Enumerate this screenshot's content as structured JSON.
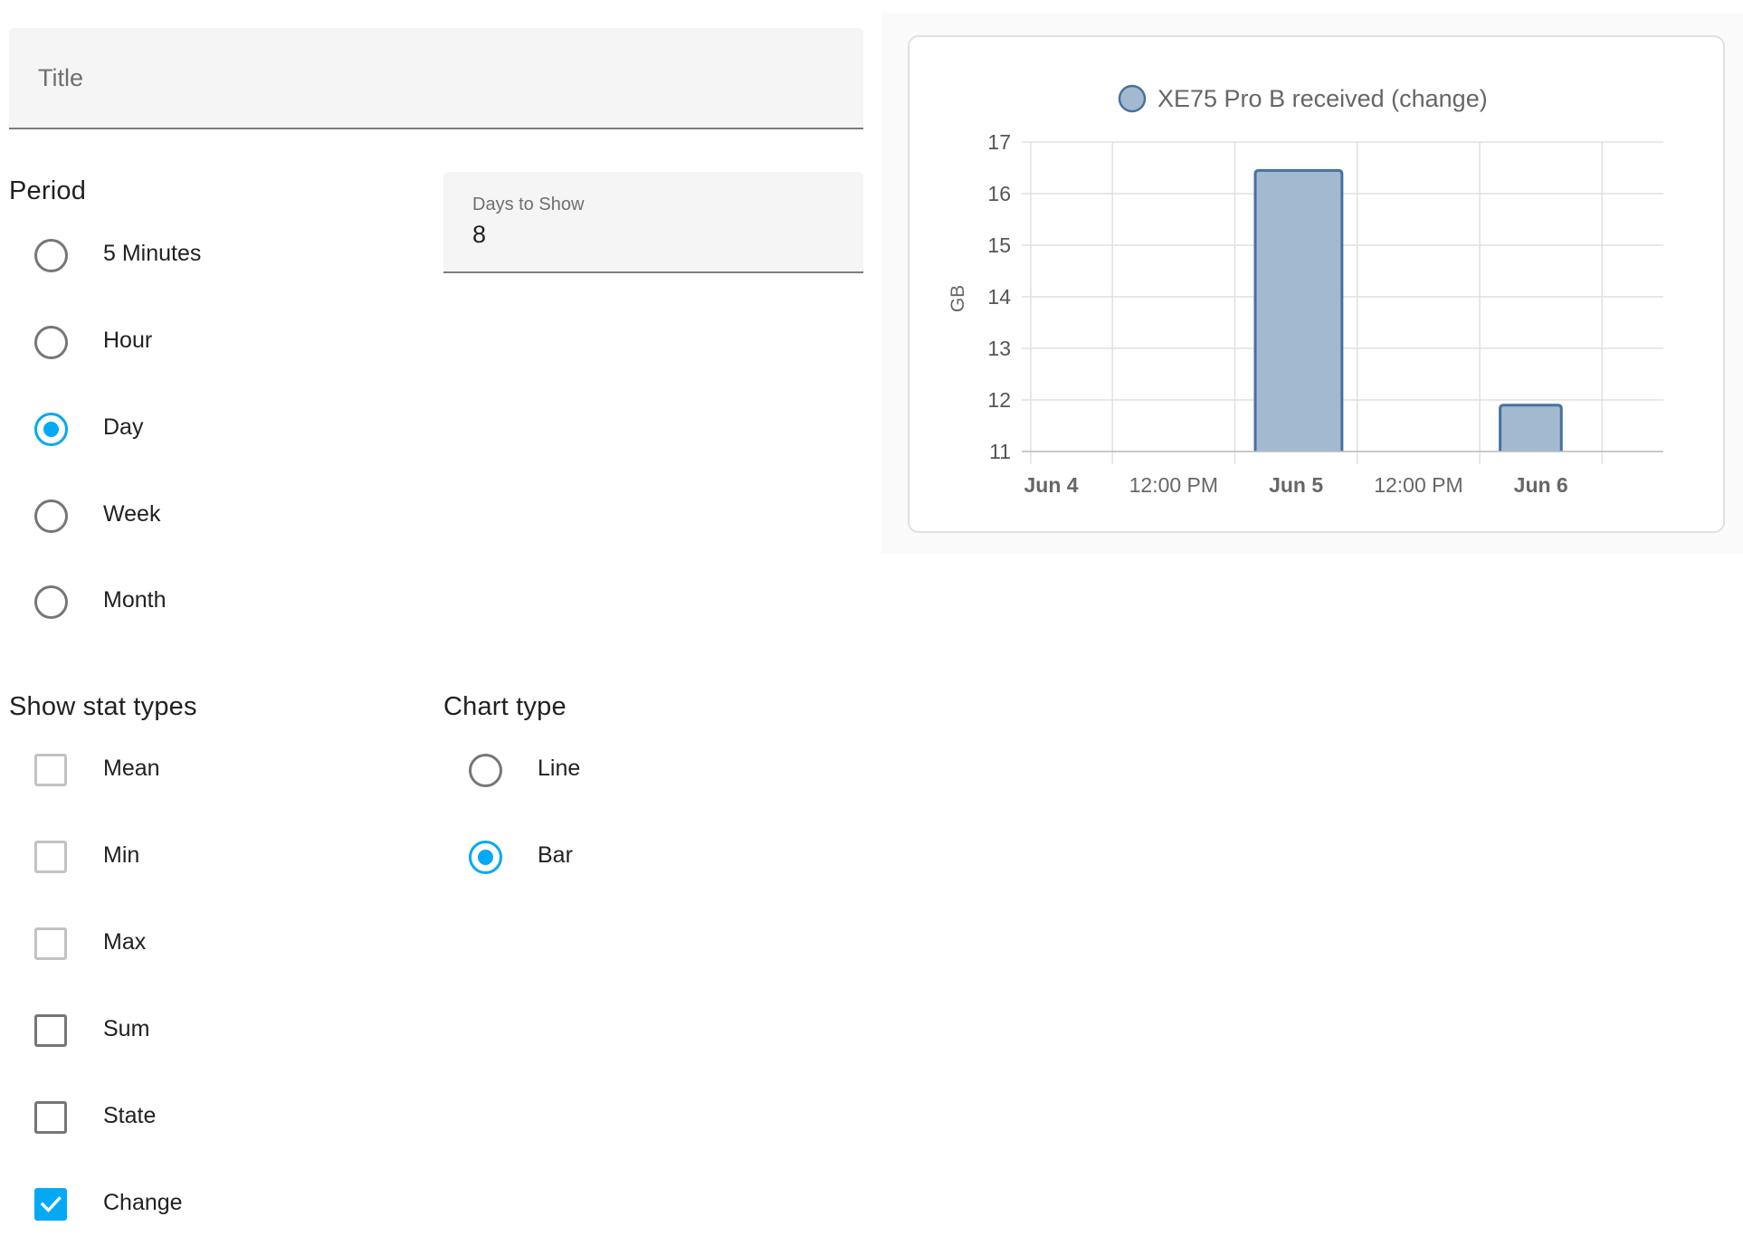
{
  "title_field": {
    "placeholder": "Title"
  },
  "period": {
    "label": "Period",
    "options": [
      {
        "label": "5 Minutes",
        "checked": false
      },
      {
        "label": "Hour",
        "checked": false
      },
      {
        "label": "Day",
        "checked": true
      },
      {
        "label": "Week",
        "checked": false
      },
      {
        "label": "Month",
        "checked": false
      }
    ]
  },
  "days_to_show": {
    "label": "Days to Show",
    "value": "8"
  },
  "stat_types": {
    "label": "Show stat types",
    "options": [
      {
        "label": "Mean",
        "checked": false,
        "disabled": true
      },
      {
        "label": "Min",
        "checked": false,
        "disabled": true
      },
      {
        "label": "Max",
        "checked": false,
        "disabled": true
      },
      {
        "label": "Sum",
        "checked": false,
        "disabled": false
      },
      {
        "label": "State",
        "checked": false,
        "disabled": false
      },
      {
        "label": "Change",
        "checked": true,
        "disabled": false
      }
    ]
  },
  "chart_type": {
    "label": "Chart type",
    "options": [
      {
        "label": "Line",
        "checked": false
      },
      {
        "label": "Bar",
        "checked": true
      }
    ]
  },
  "colors": {
    "accent": "#03a9f4",
    "bar_fill": "#a3b9cf",
    "bar_stroke": "#4672a0"
  },
  "chart_data": {
    "type": "bar",
    "legend": "XE75 Pro B received (change)",
    "ylabel": "GB",
    "ylim": [
      11,
      17
    ],
    "yticks": [
      11,
      12,
      13,
      14,
      15,
      16,
      17
    ],
    "xlim_hours": [
      -2,
      60
    ],
    "xticks": [
      {
        "label": "Jun 4",
        "hour": 0,
        "bold": true
      },
      {
        "label": "12:00 PM",
        "hour": 12,
        "bold": false
      },
      {
        "label": "Jun 5",
        "hour": 24,
        "bold": true
      },
      {
        "label": "12:00 PM",
        "hour": 36,
        "bold": false
      },
      {
        "label": "Jun 6",
        "hour": 48,
        "bold": true
      }
    ],
    "bars": [
      {
        "category": "Jun 5",
        "start_hour": 20,
        "end_hour": 28.5,
        "value": 16.45
      },
      {
        "category": "Jun 6",
        "start_hour": 44,
        "end_hour": 50,
        "value": 11.9
      }
    ]
  }
}
